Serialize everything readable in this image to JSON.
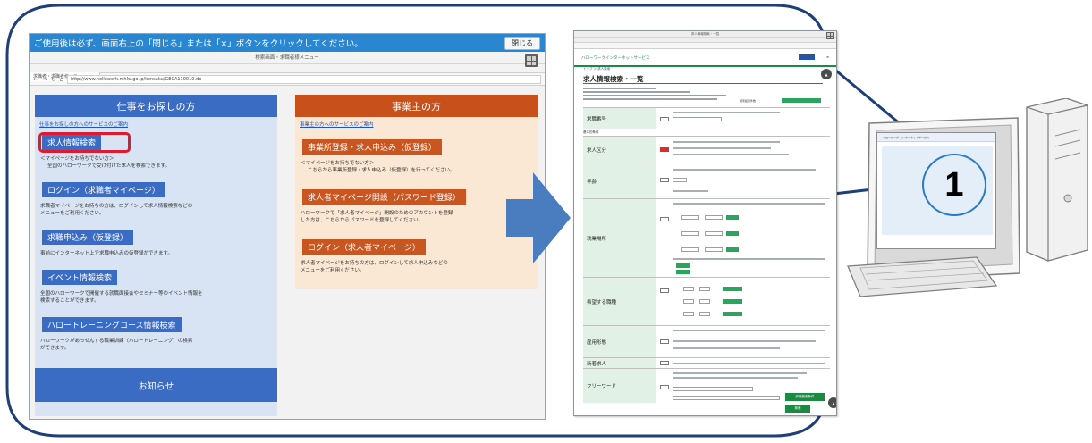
{
  "left_screen": {
    "notice_text": "ご使用後は必ず、画面右上の「閉じる」または「×」ボタンをクリックしてください。",
    "close_button": "閉じる",
    "window_title": "検索画面・求職者様メニュー",
    "tab_title": "求職者・求職者様メニュー",
    "url": "http://www.hellowork.mhlw.go.jp/kensaku/GECA110010.do",
    "seeker_panel": {
      "title": "仕事をお探しの方",
      "link": "仕事をお探しの方へのサービスのご案内",
      "items": [
        {
          "label": "求人情報検索",
          "desc1": "＜マイページをお持ちでない方＞",
          "desc2": "全国のハローワークで受け付けた求人を検索できます。"
        },
        {
          "label": "ログイン（求職者マイページ）",
          "desc1": "求職者マイページをお持ちの方は、ログインして求人情報検索などの",
          "desc2": "メニューをご利用ください。"
        },
        {
          "label": "求職申込み（仮登録）",
          "desc1": "事前にインターネット上で求職申込みの仮登録ができます。",
          "desc2": ""
        },
        {
          "label": "イベント情報検索",
          "desc1": "全国のハローワークで開催する就職面接会やセミナー等のイベント情報を",
          "desc2": "検索することができます。"
        },
        {
          "label": "ハロートレーニングコース情報検索",
          "desc1": "ハローワークがあっせんする職業訓練（ハロートレーニング）の検索",
          "desc2": "ができます。"
        }
      ],
      "news": "お知らせ"
    },
    "employer_panel": {
      "title": "事業主の方",
      "link": "事業主の方へのサービスのご案内",
      "items": [
        {
          "label": "事業所登録・求人申込み（仮登録）",
          "desc1": "＜マイページをお持ちでない方＞",
          "desc2": "こちらから事業所登録・求人申込み（仮登録）を行ってください。"
        },
        {
          "label": "求人者マイページ開設（パスワード登録）",
          "desc1": "ハローワークで「求人者マイページ」開設のためのアカウントを登録",
          "desc2": "した方は、こちらからパスワードを登録してください。"
        },
        {
          "label": "ログイン（求人者マイページ）",
          "desc1": "求人者マイページをお持ちの方は、ログインして求人申込みなどの",
          "desc2": "メニューをご利用ください。"
        }
      ]
    }
  },
  "right_screen": {
    "window_title": "求人情報検索・一覧",
    "service_name": "ハローワークインターネットサービス",
    "heading": "求人情報検索・一覧",
    "crumb": "トップ ＞ 求人検索",
    "condition_text": "検索結果件数",
    "rows": [
      {
        "label": "求職番号"
      },
      {
        "label": "求人区分"
      },
      {
        "label": "年齢"
      },
      {
        "label": "就業場所"
      },
      {
        "label": "希望する職種"
      },
      {
        "label": "雇用形態"
      },
      {
        "label": "新着求人"
      },
      {
        "label": "フリーワード"
      }
    ],
    "section_label": "基本的条件",
    "search_button": "検索",
    "detail_button": "詳細検索条件"
  },
  "computer": {
    "screen_title": "ハローワーク インターネットサービス",
    "badge": "1"
  },
  "colors": {
    "bubble_border": "#1f3f78",
    "arrow": "#4a7cc0",
    "seeker": "#3a6cc4",
    "employer": "#c8501b",
    "highlight": "#e3172e",
    "hw_green": "#1c8a43"
  }
}
